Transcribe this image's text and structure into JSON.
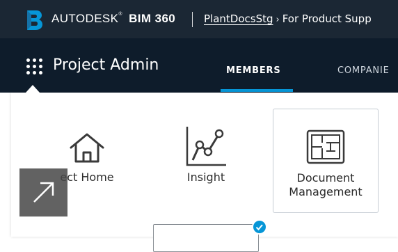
{
  "header": {
    "brand_prefix": "AUTODESK",
    "brand_product": "BIM 360",
    "brand_mark": "®",
    "breadcrumb": {
      "project": "PlantDocsStg",
      "separator": "›",
      "account": "For Product Supp"
    }
  },
  "subheader": {
    "module_title": "Project Admin",
    "tabs": [
      {
        "label": "MEMBERS",
        "active": true
      },
      {
        "label": "COMPANIE",
        "active": false
      }
    ]
  },
  "module_picker": {
    "tiles": [
      {
        "label": "ect Home",
        "icon": "home-icon"
      },
      {
        "label": "Insight",
        "icon": "insight-chart-icon"
      },
      {
        "label_line1": "Document",
        "label_line2": "Management",
        "icon": "floorplan-icon"
      }
    ]
  },
  "overlay": {
    "icon": "arrow-up-right-icon"
  },
  "colors": {
    "header_bg": "#1b2734",
    "subheader_bg": "#0e1c2b",
    "accent": "#0696d7",
    "logo_blue": "#0696d7"
  }
}
